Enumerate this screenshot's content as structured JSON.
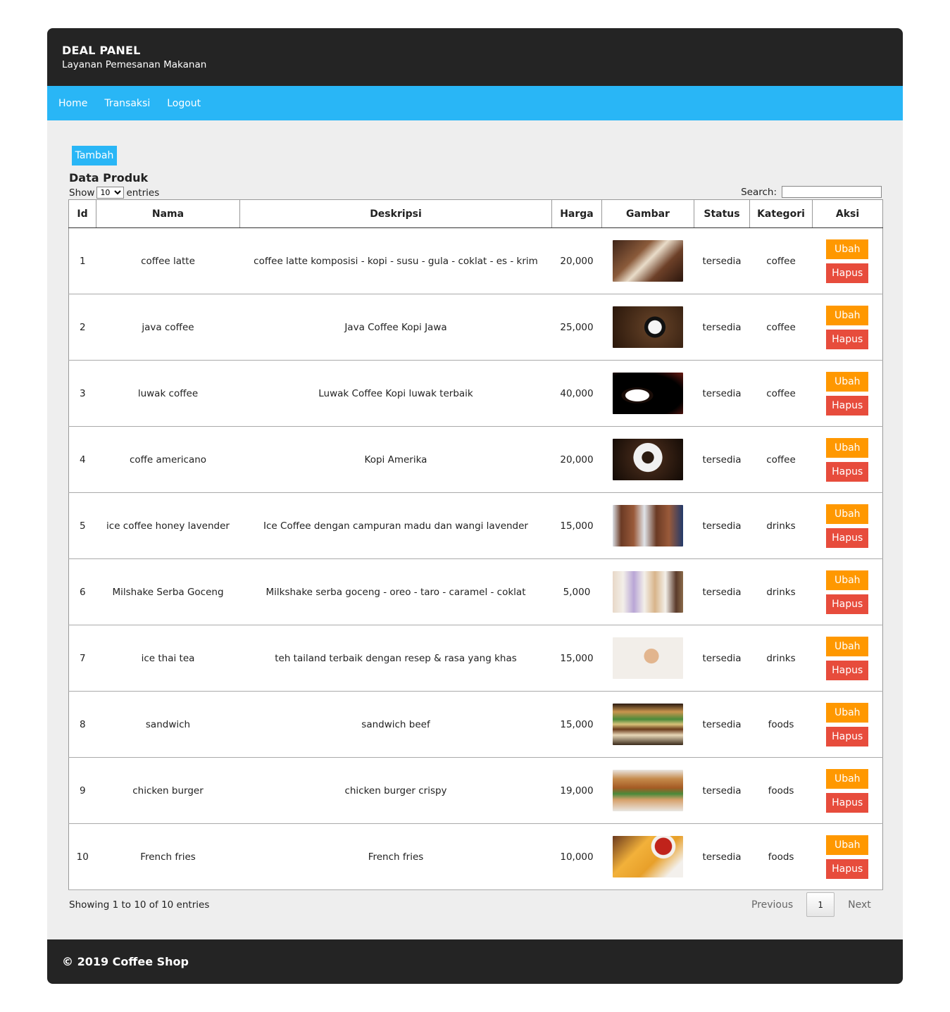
{
  "header": {
    "title": "DEAL PANEL",
    "subtitle": "Layanan Pemesanan Makanan"
  },
  "nav": {
    "items": [
      "Home",
      "Transaksi",
      "Logout"
    ]
  },
  "toolbar": {
    "add_label": "Tambah"
  },
  "section_title": "Data Produk",
  "length": {
    "prefix": "Show",
    "value": "10",
    "suffix": "entries"
  },
  "search": {
    "label": "Search:",
    "value": ""
  },
  "table": {
    "columns": [
      "Id",
      "Nama",
      "Deskripsi",
      "Harga",
      "Gambar",
      "Status",
      "Kategori",
      "Aksi"
    ],
    "rows": [
      {
        "id": "1",
        "nama": "coffee latte",
        "deskripsi": "coffee latte komposisi - kopi - susu - gula - coklat - es - krim",
        "harga": "20,000",
        "status": "tersedia",
        "kategori": "coffee",
        "image": "latte-cup-image",
        "bg": "linear-gradient(135deg,#3e2418 0%,#8a5a3a 35%,#e9dcc9 50%,#6d4028 70%,#2b160d 100%)"
      },
      {
        "id": "2",
        "nama": "java coffee",
        "deskripsi": "Java Coffee Kopi Jawa",
        "harga": "25,000",
        "status": "tersedia",
        "kategori": "coffee",
        "image": "coffee-beans-cup-image",
        "bg": "radial-gradient(circle at 60% 50%,#f5f5f5 0 14%,#111 15% 22%,#5a3a22 23%,#2a170b 100%)"
      },
      {
        "id": "3",
        "nama": "luwak coffee",
        "deskripsi": "Luwak Coffee Kopi luwak terbaik",
        "harga": "40,000",
        "status": "tersedia",
        "kategori": "coffee",
        "image": "black-coffee-cup-image",
        "bg": "radial-gradient(ellipse at 35% 55%,#ffffff 0 18%,#1a0d08 19% 24%,#000 25%,#000 70%,#6a1a12 100%)"
      },
      {
        "id": "4",
        "nama": "coffe americano",
        "deskripsi": "Kopi Amerika",
        "harga": "20,000",
        "status": "tersedia",
        "kategori": "coffee",
        "image": "americano-cup-image",
        "bg": "radial-gradient(circle at 50% 45%,#2a1a10 0 14%,#f1f1f1 15% 34%,#3c2416 35%,#120a05 100%)"
      },
      {
        "id": "5",
        "nama": "ice coffee honey lavender",
        "deskripsi": "Ice Coffee dengan campuran madu dan wangi lavender",
        "harga": "15,000",
        "status": "tersedia",
        "kategori": "drinks",
        "image": "iced-coffee-glasses-image",
        "bg": "linear-gradient(90deg,#d9dee4 0%,#6b3a24 12%,#9a5a3a 30%,#dfe3e8 45%,#6b3a24 62%,#9a5a3a 80%,#233a6a 100%)"
      },
      {
        "id": "6",
        "nama": "Milshake Serba Goceng",
        "deskripsi": "Milkshake serba goceng - oreo - taro - caramel - coklat",
        "harga": "5,000",
        "status": "tersedia",
        "kategori": "drinks",
        "image": "milkshakes-image",
        "bg": "linear-gradient(90deg,#e8d8c8 0%,#f3efe9 15%,#b9a6d6 30%,#f3efe9 45%,#d8b48a 60%,#f3efe9 75%,#5a3a2a 90%,#8a6a4a 100%)"
      },
      {
        "id": "7",
        "nama": "ice thai tea",
        "deskripsi": "teh tailand terbaik dengan resep & rasa yang khas",
        "harga": "15,000",
        "status": "tersedia",
        "kategori": "drinks",
        "image": "thai-tea-glasses-image",
        "bg": "radial-gradient(circle at 55% 45%,#e2b58e 0 16%,#f2eee9 17%),linear-gradient(90deg,#3e7a3a 0%,#f2eee9 20%)"
      },
      {
        "id": "8",
        "nama": "sandwich",
        "deskripsi": "sandwich beef",
        "harga": "15,000",
        "status": "tersedia",
        "kategori": "foods",
        "image": "sandwich-image",
        "bg": "linear-gradient(180deg,#2a1a10 0%,#c9954e 20%,#4a8a3a 38%,#d9c27a 50%,#6a3a1a 62%,#e8d8b8 76%,#3a2a1a 100%)"
      },
      {
        "id": "9",
        "nama": "chicken burger",
        "deskripsi": "chicken burger crispy",
        "harga": "19,000",
        "status": "tersedia",
        "kategori": "foods",
        "image": "chicken-burger-image",
        "bg": "linear-gradient(180deg,#e9e6e2 0%,#c58a4a 22%,#a45a24 44%,#4a8a3a 58%,#d6a06a 72%,#e9e6e2 100%)"
      },
      {
        "id": "10",
        "nama": "French fries",
        "deskripsi": "French fries",
        "harga": "10,000",
        "status": "tersedia",
        "kategori": "foods",
        "image": "french-fries-image",
        "bg": "radial-gradient(circle at 72% 25%,#c0231b 0 14%,#f3f0ec 15% 20%,transparent 21%),linear-gradient(135deg,#6b3a1e 0%,#f2b13a 35%,#e8a02a 60%,#f3f0ec 85%)"
      }
    ],
    "action_edit": "Ubah",
    "action_delete": "Hapus"
  },
  "info": "Showing 1 to 10 of 10 entries",
  "pagination": {
    "previous": "Previous",
    "page": "1",
    "next": "Next"
  },
  "footer": "© 2019 Coffee Shop",
  "colors": {
    "header_bg": "#242424",
    "nav_bg": "#29b6f6",
    "edit": "#ff9800",
    "delete": "#e74c3c",
    "content_bg": "#eeeeee"
  }
}
